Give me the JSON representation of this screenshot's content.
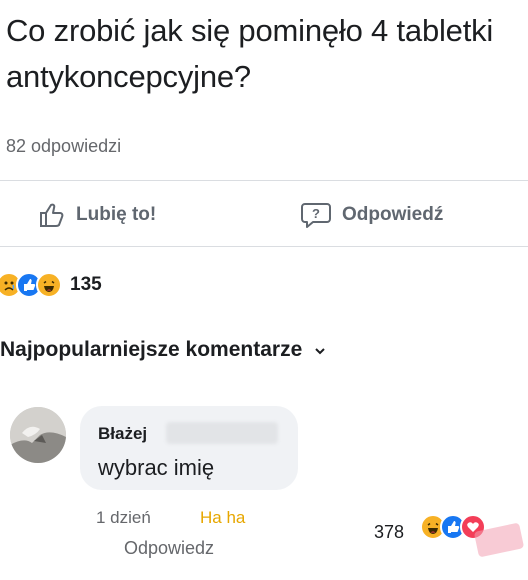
{
  "question": {
    "text": "Co zrobić jak się pominęło 4 tabletki antykoncepcyjne?"
  },
  "answers_count": "82 odpowiedzi",
  "actions": {
    "like_label": "Lubię to!",
    "reply_label": "Odpowiedź"
  },
  "reactions": {
    "icons": [
      "sad-icon",
      "like-icon",
      "haha-icon"
    ],
    "count": "135"
  },
  "comments_section": {
    "title": "Najpopularniejsze komentarze",
    "sort_icon": "chevron-down-icon"
  },
  "top_comment": {
    "author": "Błażej",
    "text": "wybrac imię",
    "time": "1 dzień",
    "reaction_link": "Ha ha",
    "reply_label": "Odpowiedz",
    "reaction_count": "378",
    "reaction_icons": [
      "haha-icon",
      "like-icon",
      "love-icon"
    ]
  },
  "colors": {
    "like_blue": "#1877f2",
    "haha_yellow": "#f7b125",
    "love_red": "#f33e58",
    "secondary_text": "#65676b"
  }
}
